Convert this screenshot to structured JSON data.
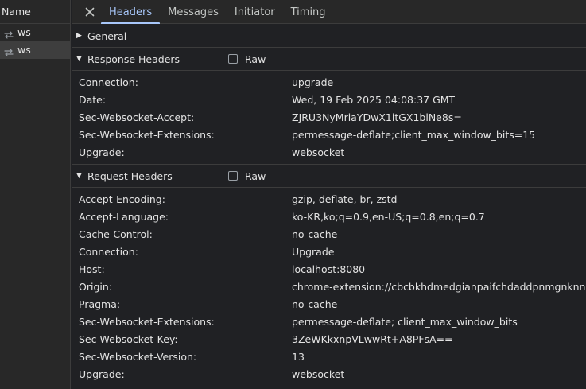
{
  "list": {
    "header": "Name",
    "items": [
      {
        "name": "ws",
        "selected": false
      },
      {
        "name": "ws",
        "selected": true
      }
    ]
  },
  "tabs": [
    "Headers",
    "Messages",
    "Initiator",
    "Timing"
  ],
  "active_tab": "Headers",
  "sections": {
    "general": {
      "title": "General",
      "expanded": false
    },
    "response": {
      "title": "Response Headers",
      "raw_label": "Raw",
      "headers": [
        {
          "k": "Connection:",
          "v": "upgrade"
        },
        {
          "k": "Date:",
          "v": "Wed, 19 Feb 2025 04:08:37 GMT"
        },
        {
          "k": "Sec-Websocket-Accept:",
          "v": "ZJRU3NyMriaYDwX1itGX1blNe8s="
        },
        {
          "k": "Sec-Websocket-Extensions:",
          "v": "permessage-deflate;client_max_window_bits=15"
        },
        {
          "k": "Upgrade:",
          "v": "websocket"
        }
      ]
    },
    "request": {
      "title": "Request Headers",
      "raw_label": "Raw",
      "headers": [
        {
          "k": "Accept-Encoding:",
          "v": "gzip, deflate, br, zstd"
        },
        {
          "k": "Accept-Language:",
          "v": "ko-KR,ko;q=0.9,en-US;q=0.8,en;q=0.7"
        },
        {
          "k": "Cache-Control:",
          "v": "no-cache"
        },
        {
          "k": "Connection:",
          "v": "Upgrade"
        },
        {
          "k": "Host:",
          "v": "localhost:8080"
        },
        {
          "k": "Origin:",
          "v": "chrome-extension://cbcbkhdmedgianpaifchdaddpnmgnknn"
        },
        {
          "k": "Pragma:",
          "v": "no-cache"
        },
        {
          "k": "Sec-Websocket-Extensions:",
          "v": "permessage-deflate; client_max_window_bits"
        },
        {
          "k": "Sec-Websocket-Key:",
          "v": "3ZeWKkxnpVLwwRt+A8PFsA=="
        },
        {
          "k": "Sec-Websocket-Version:",
          "v": "13"
        },
        {
          "k": "Upgrade:",
          "v": "websocket"
        }
      ]
    }
  },
  "colors": {
    "accent": "#a8c7fa",
    "bg": "#202124",
    "panel": "#282828"
  }
}
